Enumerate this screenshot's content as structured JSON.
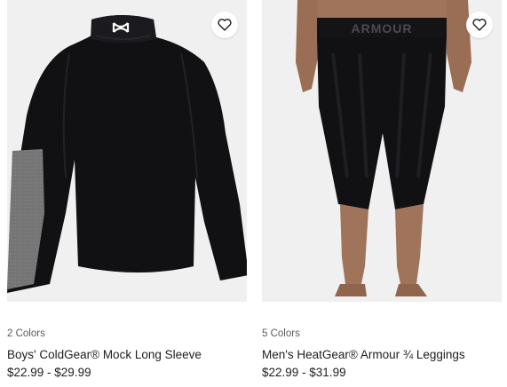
{
  "products": [
    {
      "colors_label": "2 Colors",
      "name": "Boys' ColdGear® Mock Long Sleeve",
      "price": "$22.99 - $29.99",
      "favorite_icon": "heart-outline-icon",
      "image_subject": "black mock neck long sleeve shirt with gray elbow panel"
    },
    {
      "colors_label": "5 Colors",
      "name": "Men's HeatGear® Armour ¾ Leggings",
      "price": "$22.99 - $31.99",
      "favorite_icon": "heart-outline-icon",
      "waistband_text": "ARMOUR",
      "image_subject": "man wearing black printed three-quarter leggings"
    }
  ],
  "colors": {
    "image_bg": "#f0f0f0",
    "garment": "#111114",
    "accent_gray": "#7a7a7a",
    "skin": "#a0745a"
  }
}
